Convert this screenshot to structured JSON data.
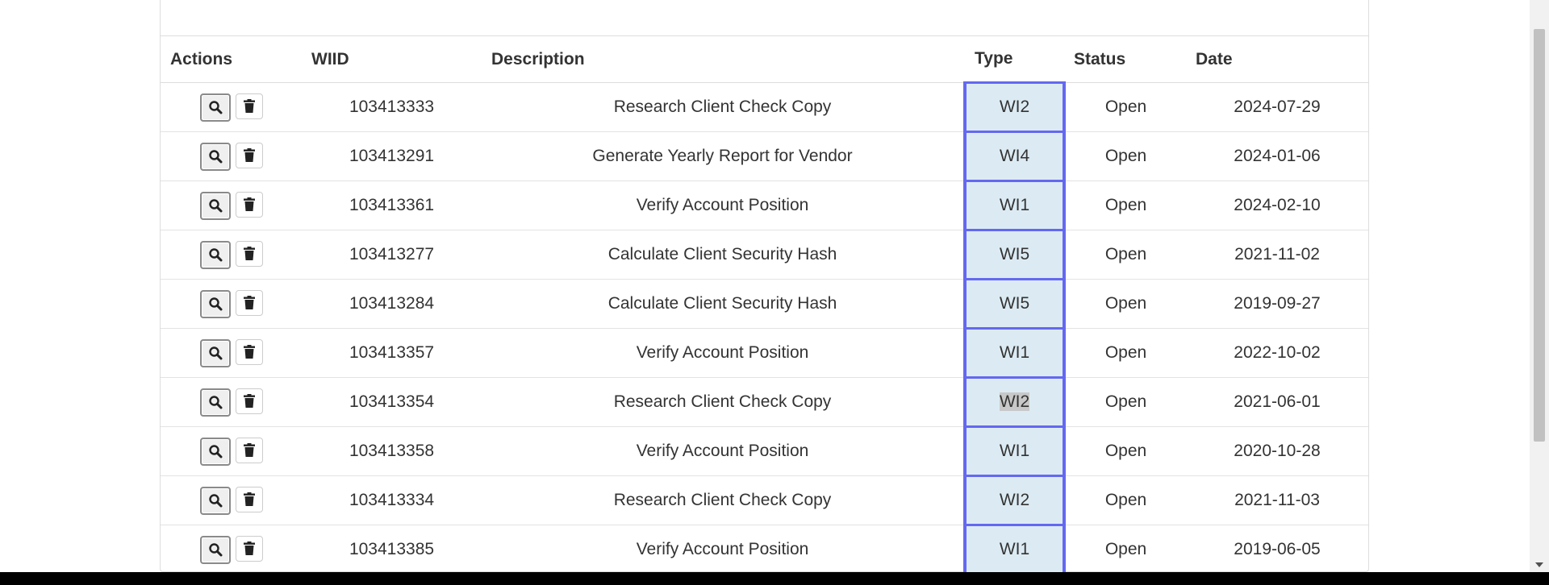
{
  "table": {
    "headers": {
      "actions": "Actions",
      "wiid": "WIID",
      "description": "Description",
      "type": "Type",
      "status": "Status",
      "date": "Date"
    },
    "rows": [
      {
        "wiid": "103413333",
        "description": "Research Client Check Copy",
        "type": "WI2",
        "status": "Open",
        "date": "2024-07-29"
      },
      {
        "wiid": "103413291",
        "description": "Generate Yearly Report for Vendor",
        "type": "WI4",
        "status": "Open",
        "date": "2024-01-06"
      },
      {
        "wiid": "103413361",
        "description": "Verify Account Position",
        "type": "WI1",
        "status": "Open",
        "date": "2024-02-10"
      },
      {
        "wiid": "103413277",
        "description": "Calculate Client Security Hash",
        "type": "WI5",
        "status": "Open",
        "date": "2021-11-02"
      },
      {
        "wiid": "103413284",
        "description": "Calculate Client Security Hash",
        "type": "WI5",
        "status": "Open",
        "date": "2019-09-27"
      },
      {
        "wiid": "103413357",
        "description": "Verify Account Position",
        "type": "WI1",
        "status": "Open",
        "date": "2022-10-02"
      },
      {
        "wiid": "103413354",
        "description": "Research Client Check Copy",
        "type": "WI2",
        "status": "Open",
        "date": "2021-06-01",
        "selected_text": true
      },
      {
        "wiid": "103413358",
        "description": "Verify Account Position",
        "type": "WI1",
        "status": "Open",
        "date": "2020-10-28"
      },
      {
        "wiid": "103413334",
        "description": "Research Client Check Copy",
        "type": "WI2",
        "status": "Open",
        "date": "2021-11-03"
      },
      {
        "wiid": "103413385",
        "description": "Verify Account Position",
        "type": "WI1",
        "status": "Open",
        "date": "2019-06-05"
      }
    ]
  },
  "icons": {
    "view": "search-icon",
    "delete": "trash-icon"
  },
  "colors": {
    "type_highlight_bg": "#dcebf3",
    "type_highlight_border": "#6468f0"
  }
}
